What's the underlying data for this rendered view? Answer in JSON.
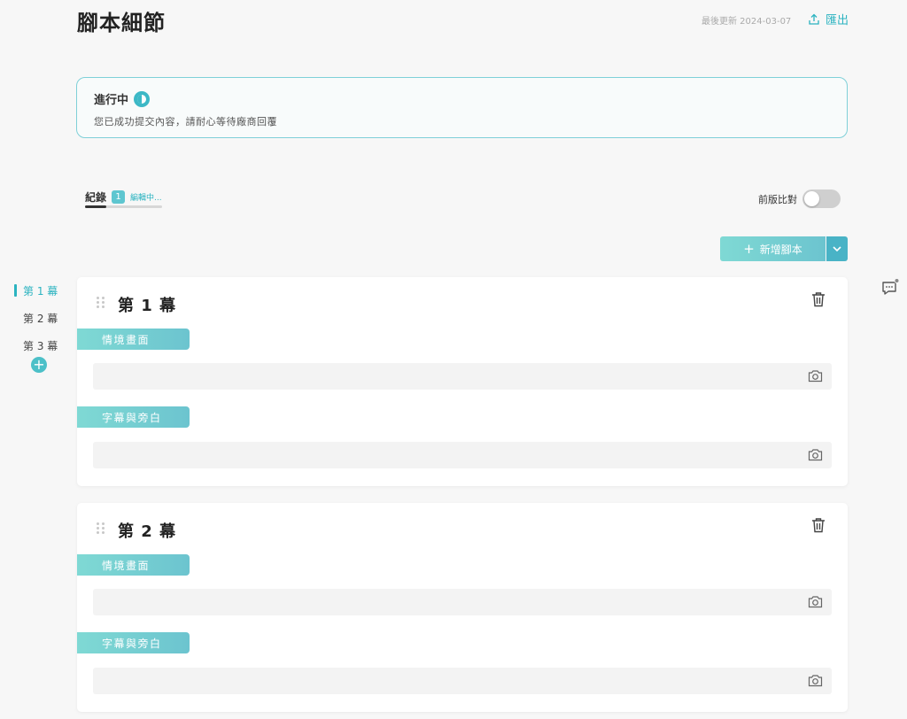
{
  "header": {
    "title": "腳本細節",
    "updated": "最後更新 2024-03-07",
    "export_label": "匯出"
  },
  "status": {
    "title": "進行中",
    "description": "您已成功提交內容，請耐心等待廠商回覆"
  },
  "records": {
    "label": "紀錄",
    "count": "1",
    "editing": "編輯中..."
  },
  "compare": {
    "label": "前版比對",
    "enabled": false
  },
  "toolbar": {
    "add_label": "新增腳本"
  },
  "side_nav": {
    "items": [
      {
        "label": "第 1 幕",
        "active": true
      },
      {
        "label": "第 2 幕",
        "active": false
      },
      {
        "label": "第 3 幕",
        "active": false
      }
    ]
  },
  "scenes": [
    {
      "title": "第 1 幕",
      "section_a": "情境畫面",
      "section_b": "字幕與旁白"
    },
    {
      "title": "第 2 幕",
      "section_a": "情境畫面",
      "section_b": "字幕與旁白"
    }
  ],
  "colors": {
    "accent": "#2bb3c0",
    "tag_gradient_start": "#7fd9d4",
    "tag_gradient_end": "#6cc4cf"
  },
  "icons": [
    "export-icon",
    "status-icon",
    "chevron-down-icon",
    "plus-icon",
    "chat-icon",
    "drag-handle-icon",
    "trash-icon",
    "camera-icon"
  ]
}
